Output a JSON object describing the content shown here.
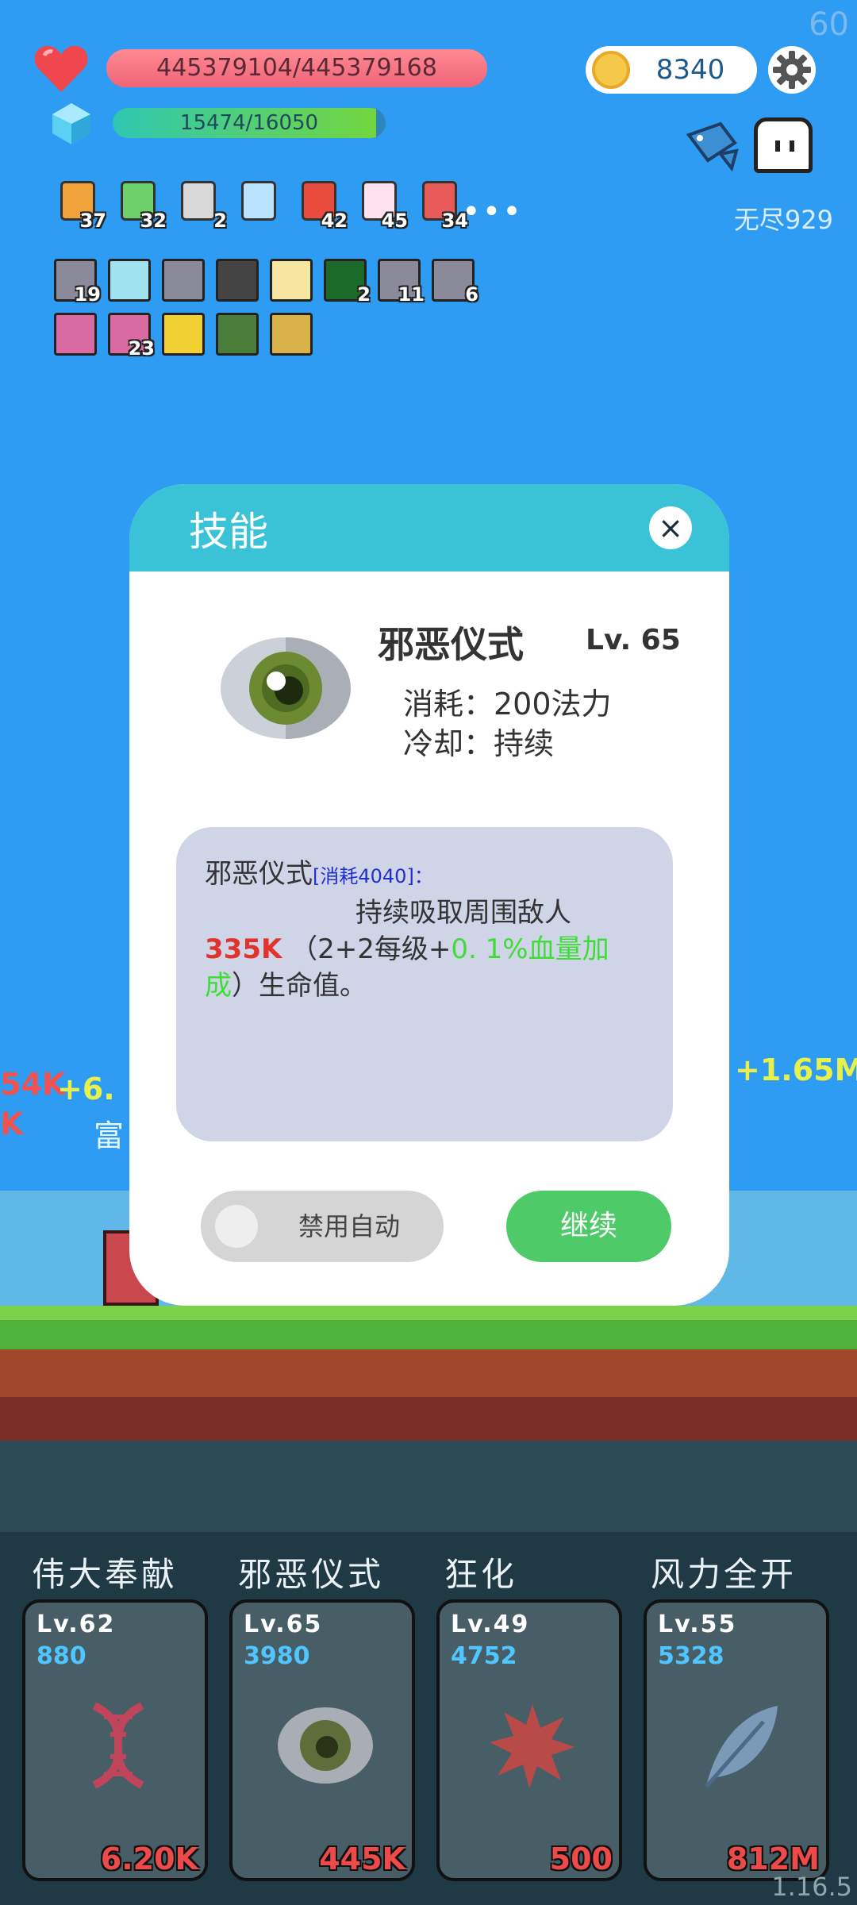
{
  "fps": "60",
  "version": "1.16.5",
  "hp": {
    "text": "445379104/445379168",
    "fraction": 0.9999998
  },
  "mp": {
    "text": "15474/16050",
    "fraction": 0.964
  },
  "coins": "8340",
  "mode": "无尽929",
  "items": [
    {
      "icon": "book-icon",
      "count": "37"
    },
    {
      "icon": "money-heart-icon",
      "count": "32"
    },
    {
      "icon": "hook-icon",
      "count": "2"
    },
    {
      "icon": "sword-icon",
      "count": ""
    },
    {
      "icon": "sock-icon",
      "count": "42"
    },
    {
      "icon": "flower-icon",
      "count": "45"
    },
    {
      "icon": "watermelon-icon",
      "count": "34"
    }
  ],
  "more_dots": "•••",
  "skills_row1": [
    {
      "icon": "slash-skill-icon",
      "count": "19",
      "color": "#8a8a9a"
    },
    {
      "icon": "light-skill-icon",
      "count": "",
      "color": "#9fe3f0"
    },
    {
      "icon": "slash-skill-icon",
      "count": "",
      "color": "#8a8a9a"
    },
    {
      "icon": "dark-blade-icon",
      "count": "",
      "color": "#444"
    },
    {
      "icon": "burst-skill-icon",
      "count": "",
      "color": "#f5e7a0"
    },
    {
      "icon": "matrix-skill-icon",
      "count": "2",
      "color": "#1c6a2a"
    },
    {
      "icon": "slash-skill-icon",
      "count": "11",
      "color": "#8a8a9a"
    },
    {
      "icon": "slash-skill-icon",
      "count": "6",
      "color": "#8a8a9a"
    }
  ],
  "skills_row2": [
    {
      "icon": "pink-rune-icon",
      "count": "",
      "color": "#d96aa2"
    },
    {
      "icon": "pink-rune-icon",
      "count": "23",
      "color": "#d96aa2"
    },
    {
      "icon": "skull-skill-icon",
      "count": "",
      "color": "#f0d033"
    },
    {
      "icon": "plant-skill-icon",
      "count": "",
      "color": "#4a7c3a"
    },
    {
      "icon": "shield-skill-icon",
      "count": "",
      "color": "#d9b24a"
    }
  ],
  "floats": {
    "left_red": "54K",
    "left_red2": "K",
    "left_yellow": "+6.",
    "left_white": "富",
    "right_yellow": "+1.65M"
  },
  "modal": {
    "title": "技能",
    "close": "×",
    "skill_name": "邪恶仪式",
    "skill_level": "Lv. 65",
    "cost": "消耗：200法力",
    "cooldown": "冷却：持续",
    "desc_name": "邪恶仪式",
    "desc_bracket_open": "[",
    "desc_cost_tag": "消耗4040",
    "desc_bracket_close": "]：",
    "desc_line1": "持续吸取周围敌人",
    "desc_value": "335K",
    "desc_mid": " （2+2每级+",
    "desc_bonus": "0. 1%血量加成",
    "desc_end": "）生命值。",
    "toggle_label": "禁用自动",
    "continue": "继续"
  },
  "skill_bar": [
    {
      "name": "伟大奉献",
      "level": "Lv.62",
      "cost": "880",
      "value": "6.20K",
      "icon": "dna-icon"
    },
    {
      "name": "邪恶仪式",
      "level": "Lv.65",
      "cost": "3980",
      "value": "445K",
      "icon": "eye-icon"
    },
    {
      "name": "狂化",
      "level": "Lv.49",
      "cost": "4752",
      "value": "500",
      "icon": "splat-icon"
    },
    {
      "name": "风力全开",
      "level": "Lv.55",
      "cost": "5328",
      "value": "812M",
      "icon": "feather-icon"
    }
  ]
}
